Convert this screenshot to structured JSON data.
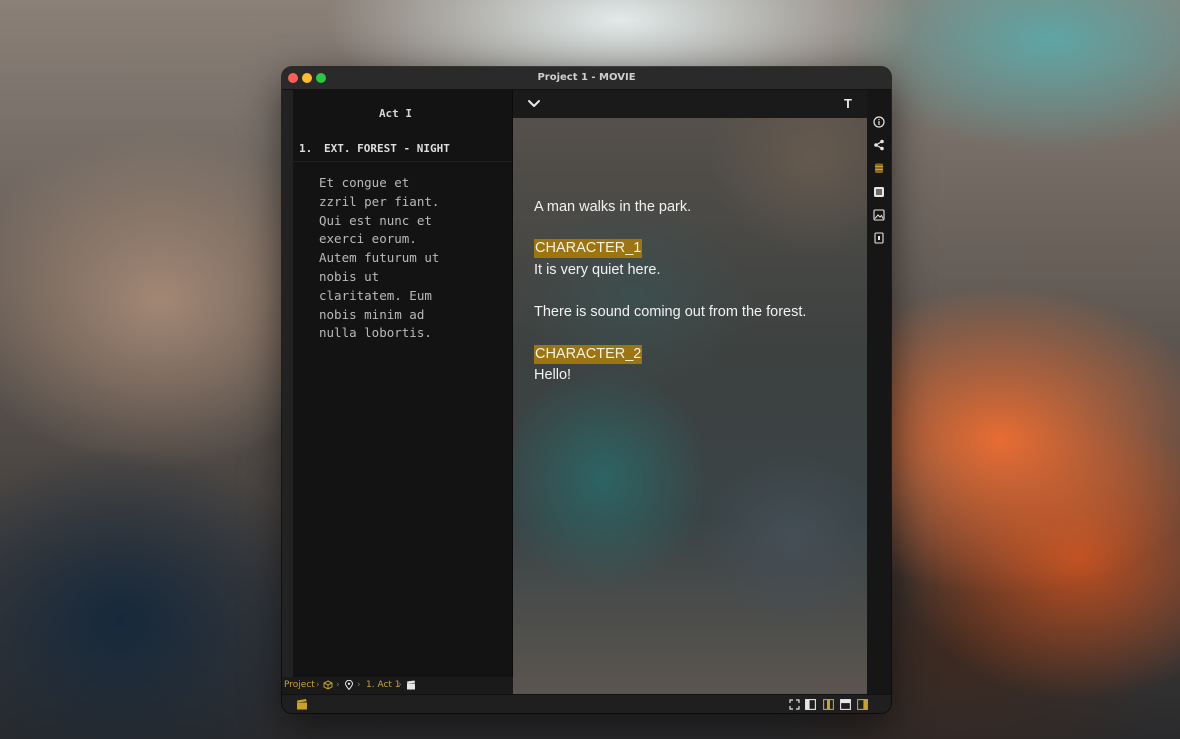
{
  "window": {
    "title": "Project 1 - MOVIE"
  },
  "outline": {
    "act_title": "Act I",
    "scene": {
      "number": "1.",
      "heading": "EXT. FOREST - NIGHT"
    },
    "synopsis_lines": [
      "Et congue et",
      "zzril per fiant.",
      "Qui est nunc et",
      "exerci eorum.",
      "Autem futurum ut",
      "nobis ut",
      "claritatem. Eum",
      "nobis minim ad",
      "nulla lobortis."
    ]
  },
  "editor": {
    "toolbar": {
      "collapse_icon": "chevron-down-icon",
      "text_label": "T"
    },
    "script": {
      "action_1": "A man walks in the park.",
      "character_1": "CHARACTER_1",
      "dialogue_1": "It is very quiet here.",
      "action_2": "There is sound coming out from the forest.",
      "character_2": "CHARACTER_2",
      "dialogue_2": "Hello!"
    }
  },
  "breadcrumb": {
    "project": "Project",
    "scene": "1. Act 1",
    "icons": [
      "cube-icon",
      "location-pin-icon",
      "clapperboard-icon"
    ]
  },
  "right_sidebar": {
    "icons": [
      "info-icon",
      "share-icon",
      "database-icon",
      "list-icon",
      "image-icon",
      "phone-icon"
    ]
  },
  "bottom_bar": {
    "left_icon": "clapperboard-icon",
    "right_icons": [
      "fullscreen-icon",
      "left-panel-icon",
      "center-panel-icon",
      "top-panel-icon",
      "right-panel-icon"
    ]
  },
  "colors": {
    "accent": "#c9a227",
    "character_highlight": "#9c7410",
    "window_bg": "#1b1b1b"
  }
}
